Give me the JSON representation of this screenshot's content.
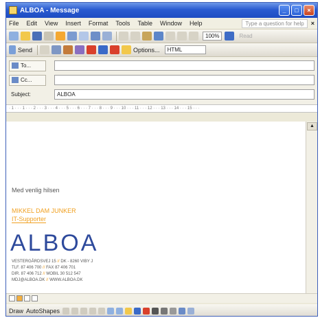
{
  "window": {
    "title": "ALBOA - Message"
  },
  "menu": {
    "items": [
      "File",
      "Edit",
      "View",
      "Insert",
      "Format",
      "Tools",
      "Table",
      "Window",
      "Help"
    ],
    "help_placeholder": "Type a question for help",
    "close_glyph": "×"
  },
  "standard_toolbar": {
    "zoom": "100%",
    "read_label": "Read"
  },
  "email_toolbar": {
    "send_label": "Send",
    "options_label": "Options...",
    "format_value": "HTML"
  },
  "fields": {
    "to_label": "To...",
    "to_value": "",
    "cc_label": "Cc...",
    "cc_value": "",
    "subject_label": "Subject:",
    "subject_value": "ALBOA"
  },
  "ruler": {
    "text": "· 1 · · · 1 · · · 2 · · · 3 · · · 4 · · · 5 · · · 6 · · · 7 · · · 8 · · · 9 · · · 10 · · · 11 · · · 12 · · · 13 · · · 14 · · · 15 · · ·"
  },
  "body": {
    "greeting": "Med venlig hilsen",
    "signature_name": "MIKKEL DAM JUNKER",
    "signature_title": "IT-Supporter",
    "logo": "ALBOA",
    "address_lines": [
      {
        "text": "VESTERGÅRDSVEJ 15",
        "extra": "DK - 8260 VIBY J"
      },
      {
        "text": "TLF. 87 406 700",
        "extra": "FAX 87 406 701"
      },
      {
        "text": "DIR. 87 406 712",
        "extra": "MOBIL 30 512 547"
      },
      {
        "text": "MDJ@ALBOA.DK",
        "extra": "WWW.ALBOA.DK"
      }
    ],
    "address_separator": "//"
  },
  "draw_toolbar": {
    "draw_label": "Draw",
    "autoshapes_label": "AutoShapes"
  },
  "colors": {
    "title_bar": "#2a5bd1",
    "signature_orange": "#f0a020",
    "logo_blue": "#2e4a9c"
  }
}
